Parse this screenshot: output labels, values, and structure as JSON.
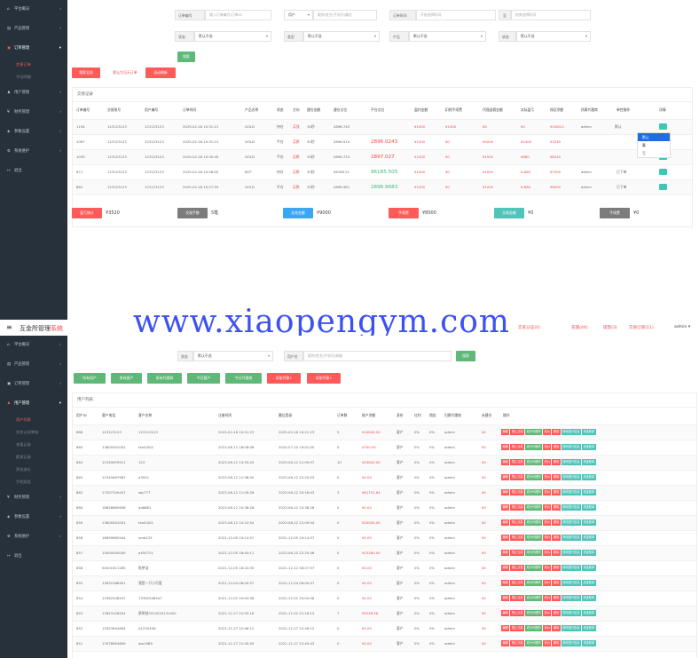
{
  "top": {
    "sidebar": [
      {
        "icon": "⌂",
        "label": "平台概况",
        "sub": []
      },
      {
        "icon": "▤",
        "label": "产品管理",
        "sub": []
      },
      {
        "icon": "▣",
        "label": "订单管理",
        "active": true,
        "sub": [
          {
            "label": "交易订单",
            "active": true
          },
          {
            "label": "平仓明细",
            "active": false
          }
        ]
      },
      {
        "icon": "♟",
        "label": "用户管理",
        "sub": []
      },
      {
        "icon": "¥",
        "label": "财务管理",
        "sub": []
      },
      {
        "icon": "◈",
        "label": "参数设置",
        "sub": []
      },
      {
        "icon": "⚙",
        "label": "系统维护",
        "sub": []
      },
      {
        "icon": "↦",
        "label": "退出",
        "sub": []
      }
    ],
    "filters": {
      "order_no_label": "订单编号",
      "order_no_placeholder": "输入订单编号/订单ID",
      "user_type": "用户",
      "user_placeholder": "昵称/姓名/手机号/编号",
      "time_label": "订单时间",
      "time_start": "开始选择时间",
      "time_to": "至",
      "time_end": "结束选择时间",
      "status_label": "状态",
      "status_value": "默认不选",
      "type_label": "类型",
      "type_value": "默认不选",
      "product_label": "产品",
      "product_value": "默认不选",
      "state_label": "状态",
      "state_value": "默认不选",
      "search": "搜索"
    },
    "actions": {
      "search_all": "搜索全部",
      "set_today": "默认为当天订单",
      "auto_refresh": "自动刷新"
    },
    "card_title": "交易记录",
    "columns": [
      "订单编号",
      "交易账号",
      "用户编号",
      "订单时间",
      "产品名称",
      "状态",
      "方向",
      "建仓金额",
      "建仓点位",
      "平仓点位",
      "盈利金额",
      "扣除手续费",
      "代理返佣金额",
      "实际盈亏",
      "保证余额",
      "所属代理商",
      "单控操作",
      "详情"
    ],
    "rows": [
      {
        "id": "1194",
        "acct": "123123123",
        "uid": "123123123",
        "time": "2025-02-18 10:31:21",
        "product": "GOLD",
        "status": "持仓",
        "dir": "买涨",
        "amount": "30秒",
        "open": "2896.745",
        "close": "",
        "profit": "¥1000",
        "fee": "¥1000",
        "agent": "¥0",
        "real": "¥0",
        "margin": "¥1064.0",
        "agent_name": "admin",
        "ctrl": "默认",
        "close_color": "red"
      },
      {
        "id": "1087",
        "acct": "123123123",
        "uid": "123123123",
        "time": "2025-02-18 10:31:21",
        "product": "GOLD",
        "status": "平仓",
        "dir": "买跌",
        "amount": "30秒",
        "open": "2896.914",
        "close": "2896.0243",
        "profit": "¥1000",
        "fee": "¥0",
        "agent": "¥5000",
        "real": "¥1400",
        "margin": "¥3240",
        "agent_name": "",
        "ctrl": "",
        "close_color": "red"
      },
      {
        "id": "1035",
        "acct": "123123123",
        "uid": "123123123",
        "time": "2025-02-18 10:30:45",
        "product": "GOLD",
        "status": "平仓",
        "dir": "买跌",
        "amount": "30秒",
        "open": "2896.724",
        "close": "2897.027",
        "profit": "¥1000",
        "fee": "¥0",
        "agent": "¥1000",
        "real": "¥880",
        "margin": "¥8240",
        "agent_name": "",
        "ctrl": "",
        "close_color": "red"
      },
      {
        "id": "871",
        "acct": "123123123",
        "uid": "123123123",
        "time": "2025-02-18 10:28:05",
        "product": "BCP",
        "status": "持仓",
        "dir": "买跌",
        "amount": "30秒",
        "open": "96185.51",
        "close": "96185.505",
        "profit": "¥1000",
        "fee": "¥0",
        "agent": "¥1000",
        "real": "¥-880",
        "margin": "¥7000",
        "agent_name": "admin",
        "ctrl": "已下单",
        "close_color": "green"
      },
      {
        "id": "862",
        "acct": "123123123",
        "uid": "123123123",
        "time": "2025-02-18 10:27:55",
        "product": "GOLD",
        "status": "平仓",
        "dir": "买跌",
        "amount": "30秒",
        "open": "2896.981",
        "close": "2896.9683",
        "profit": "¥1000",
        "fee": "¥0",
        "agent": "¥1000",
        "real": "¥-880",
        "margin": "¥8000",
        "agent_name": "admin",
        "ctrl": "已下单",
        "close_color": "green"
      }
    ],
    "dropdown": [
      "默认",
      "赢",
      "亏"
    ],
    "stats": [
      {
        "label": "盈亏统计",
        "value": "¥3520",
        "color": "#ff5a5a"
      },
      {
        "label": "交易手数",
        "value": "5笔",
        "color": "#7c7c7c"
      },
      {
        "label": "总充金额",
        "value": "¥9000",
        "color": "#3aa7f2"
      },
      {
        "label": "手续费",
        "value": "¥8000",
        "color": "#ff5a5a"
      },
      {
        "label": "交易金额",
        "value": "¥0",
        "color": "#50c4b8"
      },
      {
        "label": "手续费",
        "value": "¥0",
        "color": "#7c7c7c"
      }
    ]
  },
  "header": {
    "menu_icon": "≡",
    "title_main": "互金所管理",
    "title_accent": "系统",
    "tags": [
      {
        "text": "实名认证(0)",
        "color": "#f04848"
      },
      {
        "text": "充值(44)",
        "color": "#f04848"
      },
      {
        "text": "提现(3)",
        "color": "#f04848"
      },
      {
        "text": "交易订单(11)",
        "color": "#f04848"
      }
    ],
    "user": "admin"
  },
  "watermark": "www.xiaopengym.com",
  "bottom": {
    "sidebar": [
      {
        "icon": "⌂",
        "label": "平台概况",
        "sub": []
      },
      {
        "icon": "▤",
        "label": "产品管理",
        "sub": []
      },
      {
        "icon": "▣",
        "label": "订单管理",
        "sub": []
      },
      {
        "icon": "♟",
        "label": "用户管理",
        "active": true,
        "sub": [
          {
            "label": "用户列表",
            "active": true
          },
          {
            "label": "实名认证审核",
            "active": false
          },
          {
            "label": "充值记录",
            "active": false
          },
          {
            "label": "提现记录",
            "active": false
          },
          {
            "label": "资金流水",
            "active": false
          },
          {
            "label": "手机短信",
            "active": false
          }
        ]
      },
      {
        "icon": "¥",
        "label": "财务管理",
        "sub": []
      },
      {
        "icon": "◈",
        "label": "参数设置",
        "sub": []
      },
      {
        "icon": "⚙",
        "label": "系统维护",
        "sub": []
      },
      {
        "icon": "↦",
        "label": "退出",
        "sub": []
      }
    ],
    "filters": {
      "status_label": "状态",
      "status_value": "默认不选",
      "user_label": "用户名",
      "user_placeholder": "昵称/姓名/手机号/邮箱",
      "search": "搜索"
    },
    "tabs": [
      {
        "label": "所有用户",
        "color": "#5fb878"
      },
      {
        "label": "所有客户",
        "color": "#5fb878"
      },
      {
        "label": "所有代理商",
        "color": "#5fb878"
      },
      {
        "label": "今日客户",
        "color": "#5fb878"
      },
      {
        "label": "今日代理商",
        "color": "#5fb878"
      },
      {
        "label": "添加代理+",
        "color": "#ff5a5a"
      },
      {
        "label": "添加代理+",
        "color": "#ff5a5a"
      }
    ],
    "card_title": "用户列表",
    "columns": [
      "用户ID",
      "客户电话",
      "客户名称",
      "注册时间",
      "最后登录",
      "订单数",
      "账户余额",
      "身份",
      "红利",
      "佣金",
      "归属代理商",
      "未建仓",
      "操作"
    ],
    "ops": [
      {
        "label": "编辑",
        "color": "#ff5a5a"
      },
      {
        "label": "禁止交易",
        "color": "#ff5a5a"
      },
      {
        "label": "成为代理商",
        "color": "#5fb878"
      },
      {
        "label": "改价",
        "color": "#ff5a5a"
      },
      {
        "label": "删除",
        "color": "#ff5a5a"
      },
      {
        "label": "修改银行信息",
        "color": "#50c4b8"
      },
      {
        "label": "资金账单",
        "color": "#50c4b8"
      }
    ],
    "rows": [
      {
        "id": "866",
        "phone": "123123123",
        "name": "123123123",
        "reg": "2025-02-18 10:21:23",
        "last": "2025-02-18 10:21:23",
        "orders": "5",
        "balance": "¥10640.00",
        "role": "客户",
        "bonus": "0%",
        "comm": "0%",
        "agent": "admin",
        "open": "¥0",
        "bal_red": true
      },
      {
        "id": "865",
        "phone": "13800001002",
        "name": "test1002",
        "reg": "2023-06-12 18:08:08",
        "last": "2024-07-10 19:01:00",
        "orders": "0",
        "balance": "¥700.00",
        "role": "客户",
        "bonus": "0%",
        "comm": "0%",
        "agent": "admin",
        "open": "¥0",
        "bal_red": true
      },
      {
        "id": "864",
        "phone": "12345679911",
        "name": "123",
        "reg": "2023-06-12 14:35:29",
        "last": "2023-06-12 21:09:57",
        "orders": "10",
        "balance": "¥53800.00",
        "role": "客户",
        "bonus": "0%",
        "comm": "0%",
        "agent": "admin",
        "open": "¥0",
        "bal_red": true
      },
      {
        "id": "863",
        "phone": "12345697987",
        "name": "a3521",
        "reg": "2023-06-12 12:38:00",
        "last": "2023-06-12 22:25:53",
        "orders": "0",
        "balance": "¥0.00",
        "role": "客户",
        "bonus": "0%",
        "comm": "0%",
        "agent": "admin",
        "open": "¥0",
        "bal_red": true
      },
      {
        "id": "862",
        "phone": "17507209457",
        "name": "wjs777",
        "reg": "2023-06-12 11:09:26",
        "last": "2023-06-12 20:16:03",
        "orders": "3",
        "balance": "¥81731.64",
        "role": "客户",
        "bonus": "0%",
        "comm": "0%",
        "agent": "admin",
        "open": "¥0",
        "bal_red": true
      },
      {
        "id": "860",
        "phone": "18628865656",
        "name": "aa8881",
        "reg": "2023-06-12 10:38:26",
        "last": "2023-06-12 10:38:26",
        "orders": "0",
        "balance": "¥0.00",
        "role": "客户",
        "bonus": "0%",
        "comm": "0%",
        "agent": "admin",
        "open": "¥0",
        "bal_red": true
      },
      {
        "id": "859",
        "phone": "13800001001",
        "name": "test1001",
        "reg": "2023-06-12 10:22:54",
        "last": "2023-06-12 21:09:44",
        "orders": "0",
        "balance": "¥20000.00",
        "role": "客户",
        "bonus": "0%",
        "comm": "0%",
        "agent": "admin",
        "open": "¥0",
        "bal_red": true
      },
      {
        "id": "858",
        "phone": "18699665544",
        "name": "xmb123",
        "reg": "2021-12-05 19:14:57",
        "last": "2021-12-05 19:14:57",
        "orders": "0",
        "balance": "¥0.00",
        "role": "客户",
        "bonus": "0%",
        "comm": "0%",
        "agent": "admin",
        "open": "¥0",
        "bal_red": true
      },
      {
        "id": "857",
        "phone": "13000000000",
        "name": "a450721",
        "reg": "2021-12-05 18:45:11",
        "last": "2023-06-10 22:25:46",
        "orders": "0",
        "balance": "¥15280.00",
        "role": "客户",
        "bonus": "0%",
        "comm": "0%",
        "agent": "admin",
        "open": "¥0",
        "bal_red": true
      },
      {
        "id": "856",
        "phone": "00001611285",
        "name": "陈梦浩",
        "reg": "2021-12-05 18:24:35",
        "last": "2021-12-12 08:27:57",
        "orders": "0",
        "balance": "¥0.00",
        "role": "客户",
        "bonus": "0%",
        "comm": "0%",
        "agent": "admin",
        "open": "¥0",
        "bal_red": true
      },
      {
        "id": "855",
        "phone": "13632288901",
        "name": "我是一只小可爱",
        "reg": "2021-12-04 08:00:37",
        "last": "2021-12-04 08:00:57",
        "orders": "0",
        "balance": "¥0.00",
        "role": "客户",
        "bonus": "0%",
        "comm": "0%",
        "agent": "admin",
        "open": "¥0",
        "bal_red": true
      },
      {
        "id": "854",
        "phone": "13362548547",
        "name": "13362548547",
        "reg": "2021-12-01 20:04:06",
        "last": "2021-12-01 20:04:06",
        "orders": "0",
        "balance": "¥0.00",
        "role": "客户",
        "bonus": "0%",
        "comm": "0%",
        "agent": "admin",
        "open": "¥0",
        "bal_red": true
      },
      {
        "id": "853",
        "phone": "13623128504",
        "name": "蔡明进3314520131452",
        "reg": "2021-11-27 22:55:16",
        "last": "2021-12-02 21:16:13",
        "orders": "7",
        "balance": "¥5248.56",
        "role": "客户",
        "bonus": "0%",
        "comm": "0%",
        "agent": "admin",
        "open": "¥0",
        "bal_red": true
      },
      {
        "id": "852",
        "phone": "13523644894",
        "name": "A1230456",
        "reg": "2021-11-27 22:46:12",
        "last": "2021-11-27 22:46:12",
        "orders": "0",
        "balance": "¥0.00",
        "role": "客户",
        "bonus": "0%",
        "comm": "0%",
        "agent": "admin",
        "open": "¥0",
        "bal_red": true
      },
      {
        "id": "851",
        "phone": "13578654609",
        "name": "ww1989",
        "reg": "2021-11-27 22:45:43",
        "last": "2021-11-27 22:45:43",
        "orders": "0",
        "balance": "¥0.00",
        "role": "客户",
        "bonus": "0%",
        "comm": "0%",
        "agent": "admin",
        "open": "¥0",
        "bal_red": true
      }
    ]
  }
}
